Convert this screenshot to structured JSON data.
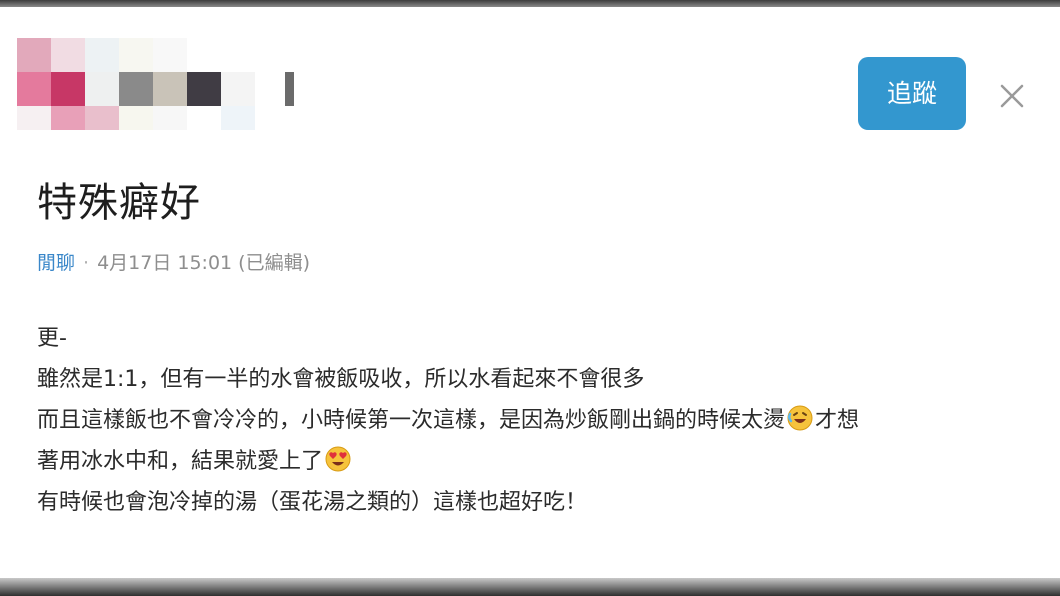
{
  "header": {
    "follow_label": "追蹤",
    "close_icon": "close-icon",
    "avatar_icon": "pixelated-avatar"
  },
  "post": {
    "title": "特殊癖好",
    "forum": "閒聊",
    "separator": "·",
    "timestamp": "4月17日 15:01 (已編輯)",
    "lines": [
      "更-",
      "雖然是1:1，但有一半的水會被飯吸收，所以水看起來不會很多",
      "而且這樣飯也不會冷冷的，小時候第一次這樣，是因為炒飯剛出鍋的時候太燙",
      "才想",
      "著用冰水中和，結果就愛上了",
      "有時候也會泡冷掉的湯（蛋花湯之類的）這樣也超好吃！"
    ]
  },
  "colors": {
    "accent": "#3397cf",
    "forum_link": "#3a87c9",
    "meta_text": "#8e8e8e",
    "title_text": "#1e1e1e"
  }
}
